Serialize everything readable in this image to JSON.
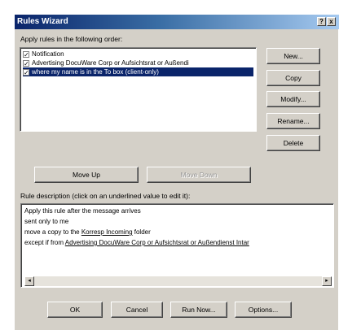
{
  "window": {
    "title": "Rules Wizard",
    "help_glyph": "?",
    "close_glyph": "x"
  },
  "order_label": "Apply rules in the following order:",
  "rules": [
    {
      "label": "Notification",
      "checked": true,
      "selected": false
    },
    {
      "label": "Advertising DocuWare Corp or Aufsichtsrat or Außendi",
      "checked": true,
      "selected": false
    },
    {
      "label": "where my name is in the To box  (client-only)",
      "checked": true,
      "selected": true
    }
  ],
  "side_buttons": {
    "new": "New...",
    "copy": "Copy",
    "modify": "Modify...",
    "rename": "Rename...",
    "delete": "Delete"
  },
  "move_buttons": {
    "up": "Move Up",
    "down": "Move Down"
  },
  "description_label": "Rule description (click on an underlined value to edit it):",
  "description": {
    "line1": "Apply this rule after the message arrives",
    "line2": "sent only to me",
    "line3_pre": "move a copy to the ",
    "line3_link": "Korresp Incoming",
    "line3_post": " folder",
    "line4_pre": "except if from ",
    "line4_link": "Advertising DocuWare Corp or Aufsichtsrat or Außendienst Intar"
  },
  "bottom_buttons": {
    "ok": "OK",
    "cancel": "Cancel",
    "run_now": "Run Now...",
    "options": "Options..."
  }
}
